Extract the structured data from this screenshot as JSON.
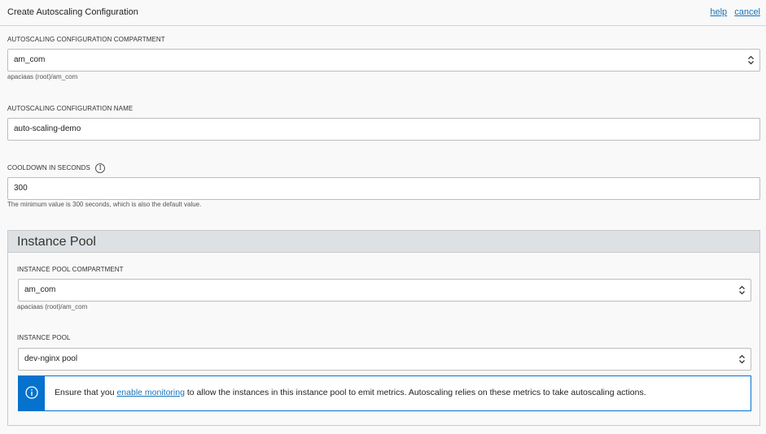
{
  "header": {
    "title": "Create Autoscaling Configuration",
    "help_label": "help",
    "cancel_label": "cancel"
  },
  "compartment": {
    "label": "AUTOSCALING CONFIGURATION COMPARTMENT",
    "value": "am_com",
    "path": "apaciaas (root)/am_com"
  },
  "name": {
    "label": "AUTOSCALING CONFIGURATION NAME",
    "value": "auto-scaling-demo"
  },
  "cooldown": {
    "label": "COOLDOWN IN SECONDS",
    "value": "300",
    "hint": "The minimum value is 300 seconds, which is also the default value."
  },
  "instance_pool_section": {
    "title": "Instance Pool",
    "compartment_label": "INSTANCE POOL COMPARTMENT",
    "compartment_value": "am_com",
    "compartment_path": "apaciaas (root)/am_com",
    "pool_label": "INSTANCE POOL",
    "pool_value": "dev-nginx pool"
  },
  "notice": {
    "prefix": "Ensure that you ",
    "link": "enable monitoring",
    "suffix": " to allow the instances in this instance pool to emit metrics. Autoscaling relies on these metrics to take autoscaling actions."
  },
  "colors": {
    "link": "#1a73b8",
    "info_accent": "#0572ce",
    "section_header_bg": "#dde1e4"
  },
  "icons": {
    "select_chevron": "chevron-up-down-icon",
    "info": "info-icon"
  }
}
